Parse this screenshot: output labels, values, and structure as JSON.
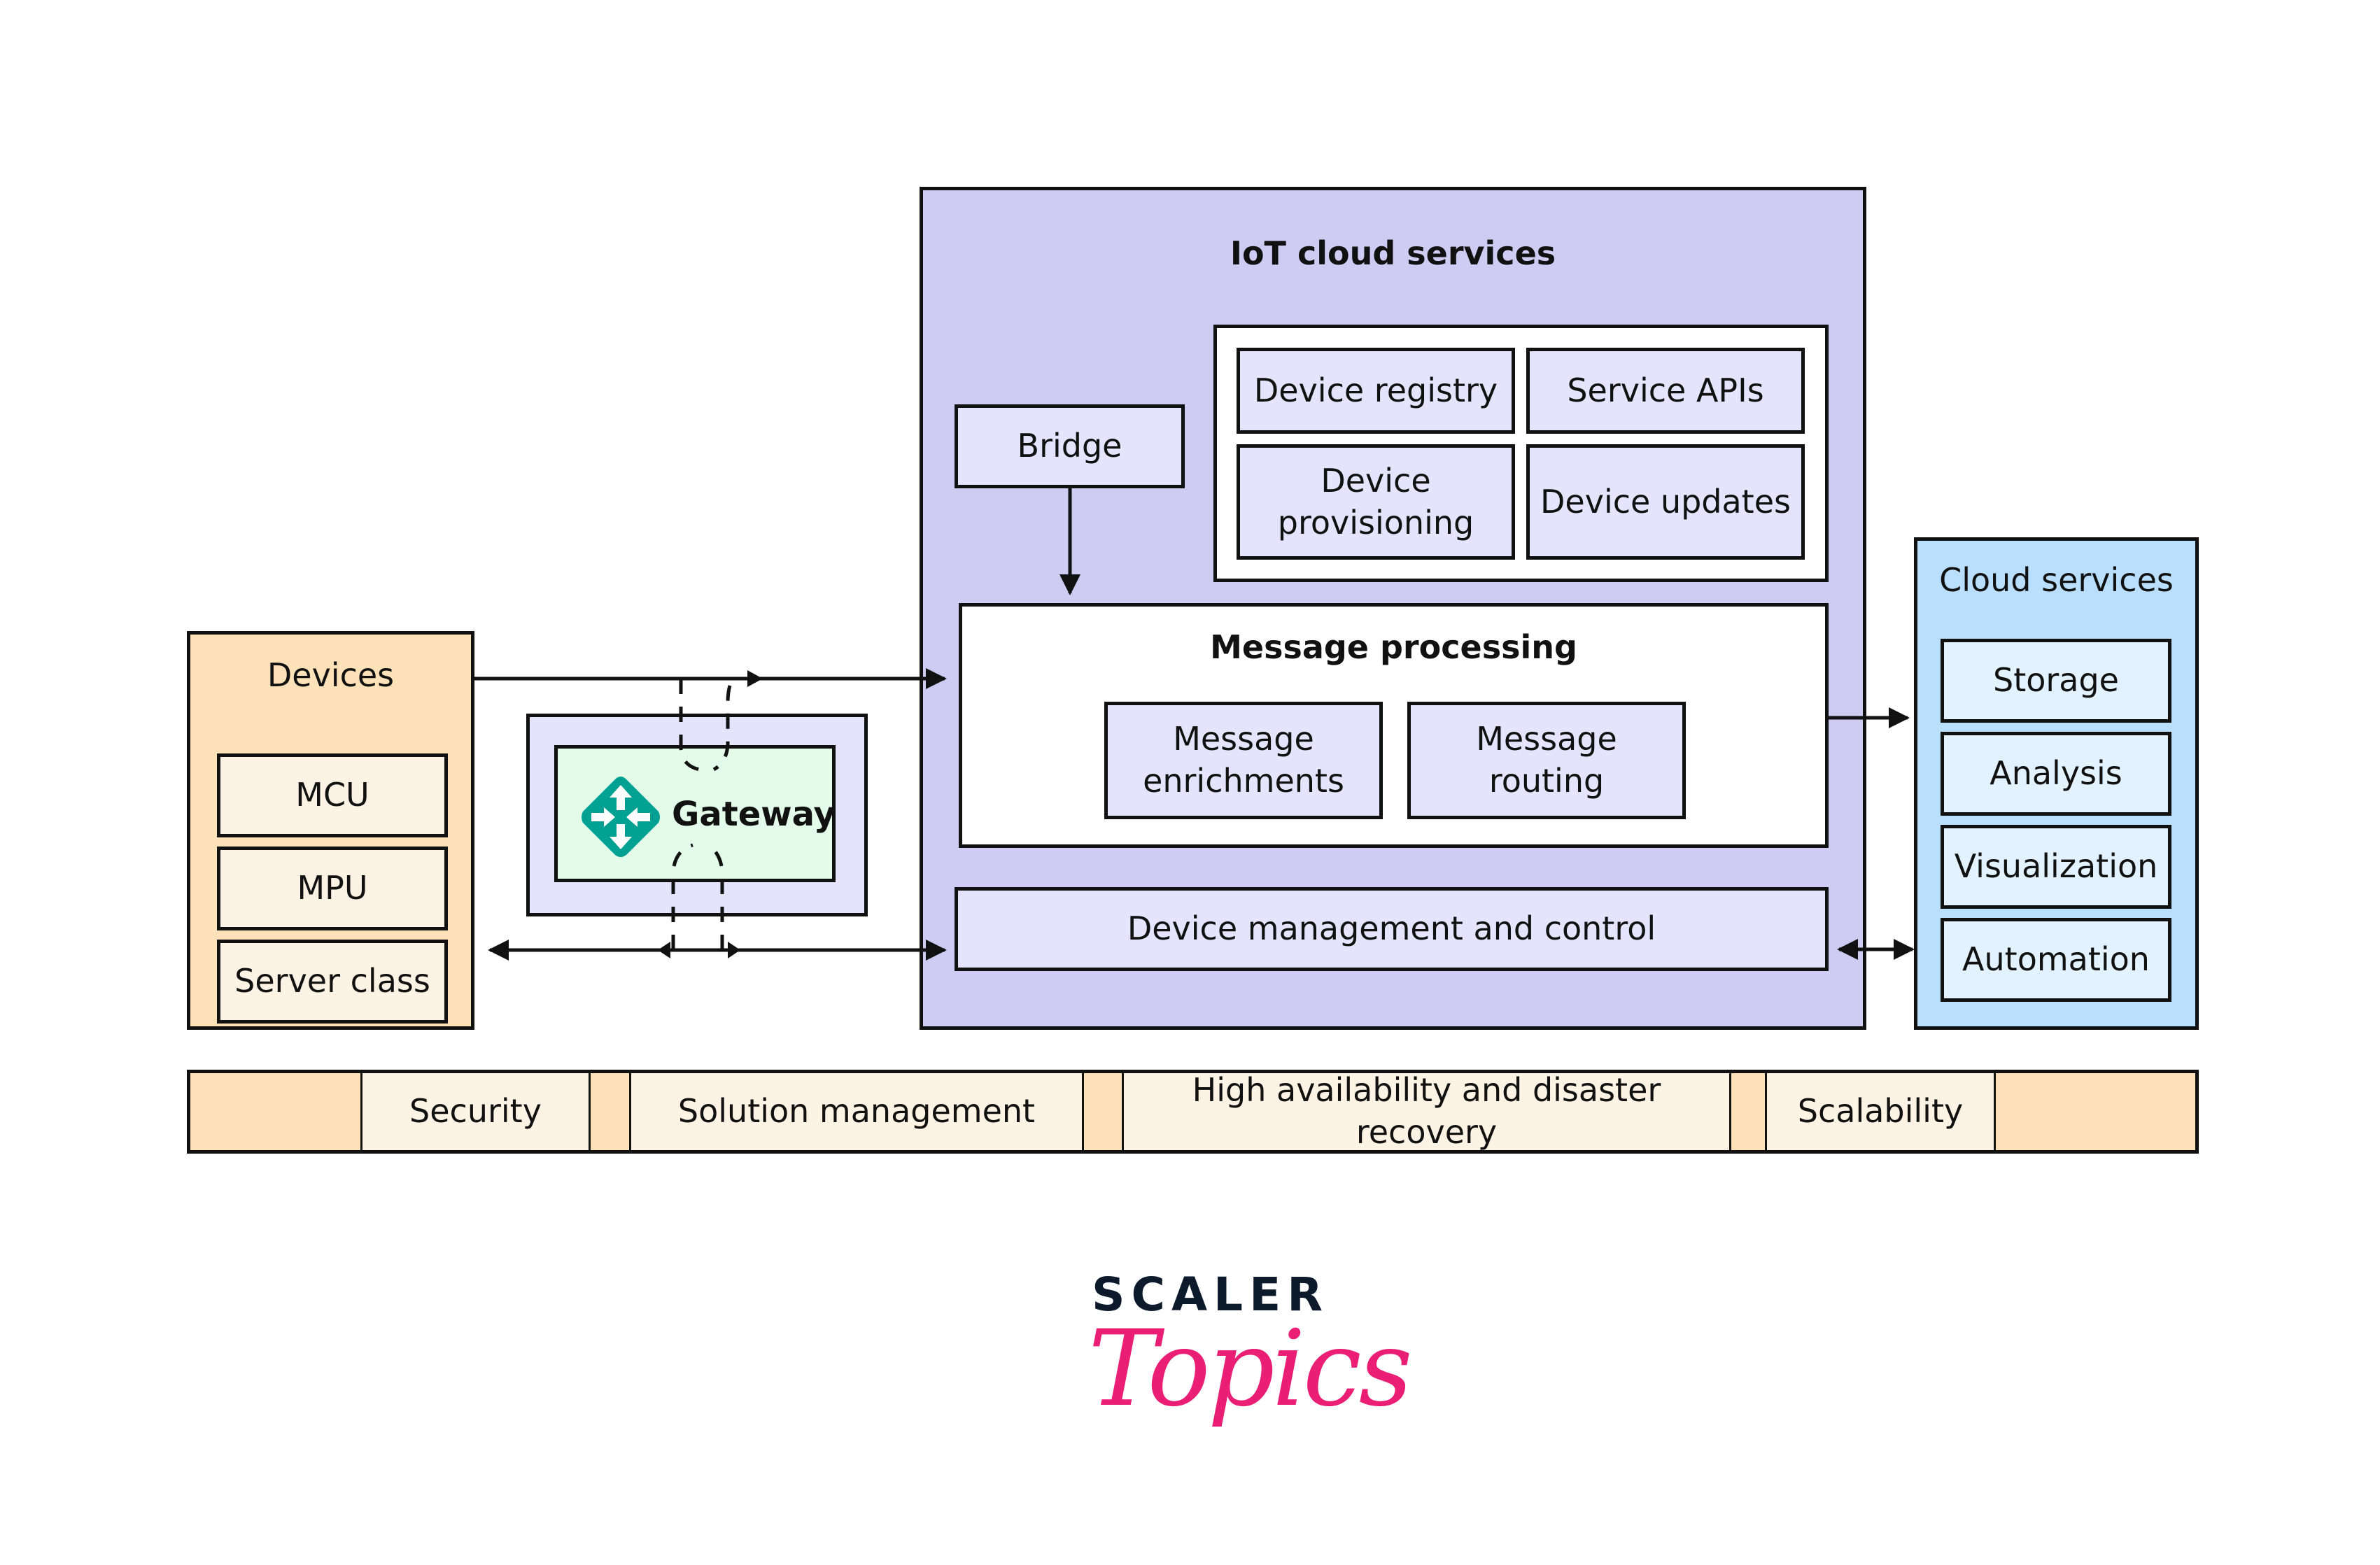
{
  "devices": {
    "title": "Devices",
    "items": [
      "MCU",
      "MPU",
      "Server class"
    ]
  },
  "gateway": {
    "label": "Gateway",
    "icon": "gateway-arrows-icon"
  },
  "iot_cloud": {
    "title": "IoT cloud services",
    "bridge": "Bridge",
    "management": {
      "device_registry": "Device registry",
      "service_apis": "Service APIs",
      "device_provisioning": "Device provisioning",
      "device_updates": "Device updates"
    },
    "message_processing": {
      "title": "Message processing",
      "enrichments": "Message enrichments",
      "routing": "Message routing"
    },
    "device_management": "Device management and control"
  },
  "cloud_services": {
    "title": "Cloud services",
    "items": [
      "Storage",
      "Analysis",
      "Visualization",
      "Automation"
    ]
  },
  "crosscutting": [
    "Security",
    "Solution management",
    "High availability and disaster recovery",
    "Scalability"
  ],
  "logo": {
    "top": "SCALER",
    "bottom": "Topics"
  },
  "colors": {
    "devices_bg": "#FDE1B8",
    "devices_item_bg": "#FDF3E4",
    "iot_bg": "#D0CBF3",
    "iot_item_bg": "#E6E4FC",
    "cloud_bg": "#B9DFFD",
    "cloud_item_bg": "#E3F2FF",
    "gateway_bg": "#E2FCE9",
    "gateway_icon": "#00A092",
    "logo_dark": "#0C1A2C",
    "logo_pink": "#E91E74"
  }
}
